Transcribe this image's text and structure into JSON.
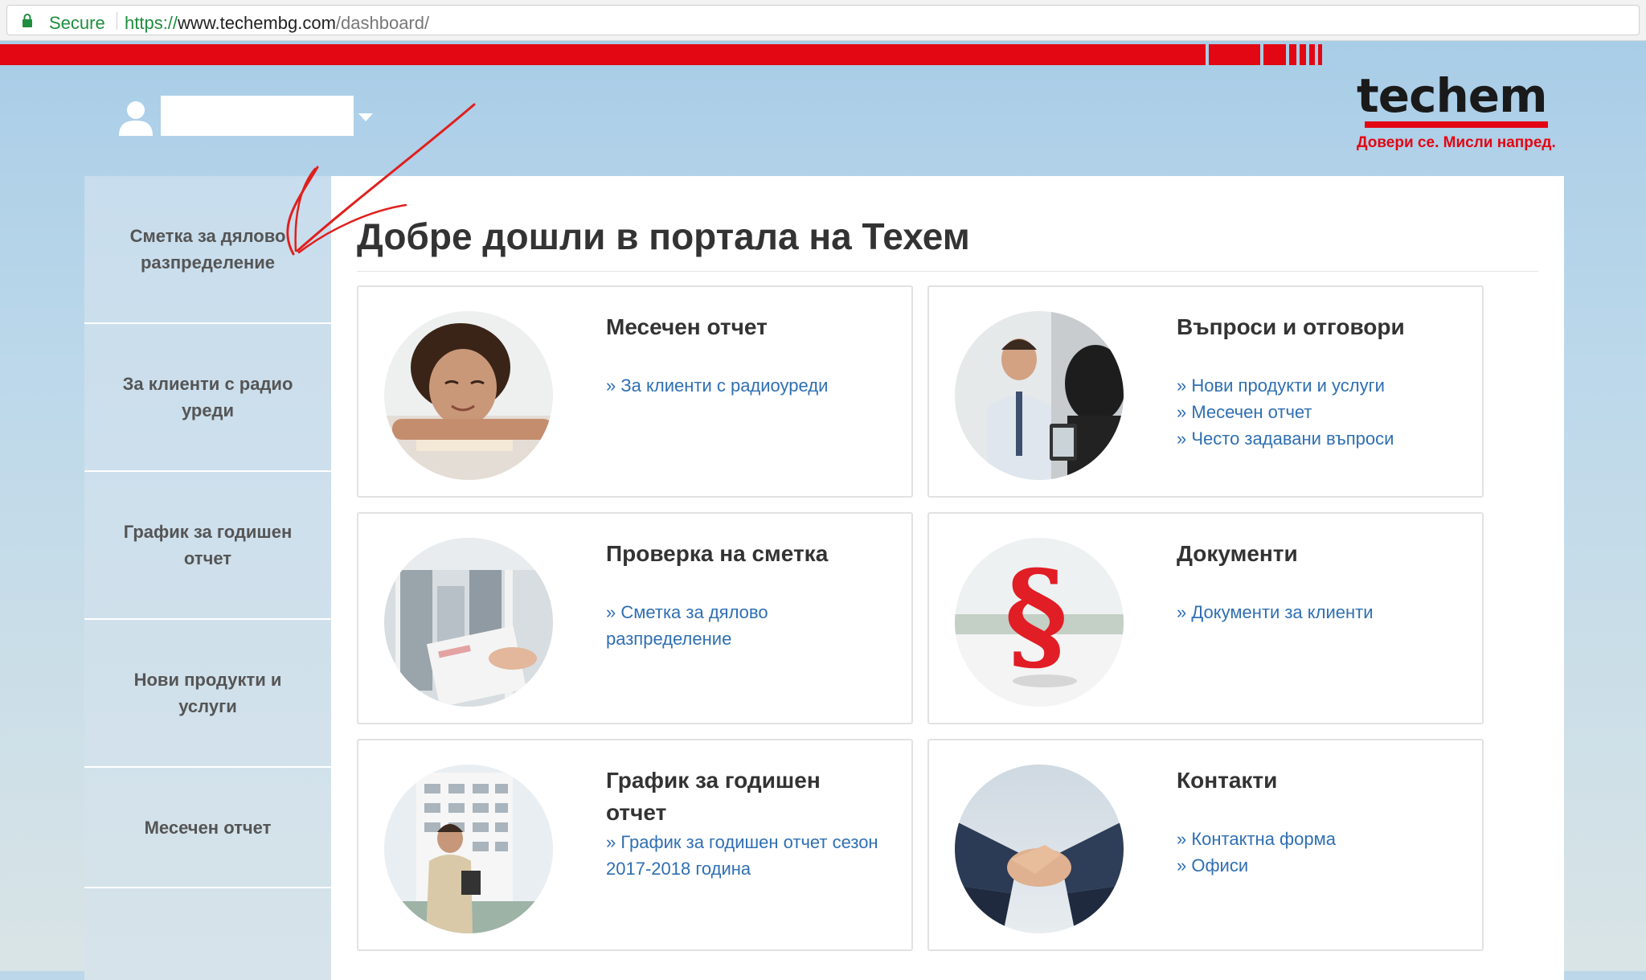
{
  "browser": {
    "secure_label": "Secure",
    "url_scheme": "https://",
    "url_host": "www.techembg.com",
    "url_path": "/dashboard/"
  },
  "brand": {
    "logo_text": "techem",
    "tagline": "Довери се. Мисли напред.",
    "accent_color": "#e30613"
  },
  "sidebar": {
    "items": [
      {
        "label": "Сметка за дялово разпределение"
      },
      {
        "label": "За клиенти с радио уреди"
      },
      {
        "label": "График за годишен отчет"
      },
      {
        "label": "Нови продукти и услуги"
      },
      {
        "label": "Месечен отчет"
      }
    ]
  },
  "main": {
    "title": "Добре дошли в портала на Техем",
    "cards": [
      {
        "title": "Месечен отчет",
        "image": "woman-portrait",
        "links": [
          "» За клиенти с радиоуреди"
        ]
      },
      {
        "title": "Въпроси и отговори",
        "image": "business-meeting",
        "links": [
          "» Нови продукти и услуги",
          "» Месечен отчет",
          "» Често задавани въпроси"
        ]
      },
      {
        "title": "Проверка на сметка",
        "image": "bill-window",
        "links": [
          "» Сметка за дялово разпределение"
        ]
      },
      {
        "title": "Документи",
        "image": "paragraph-sign",
        "links": [
          "» Документи за клиенти"
        ]
      },
      {
        "title": "График за годишен отчет",
        "image": "man-building",
        "links": [
          "» График за годишен отчет сезон 2017-2018 година"
        ]
      },
      {
        "title": "Контакти",
        "image": "handshake",
        "links": [
          "» Контактна форма",
          "» Офиси"
        ]
      }
    ]
  }
}
